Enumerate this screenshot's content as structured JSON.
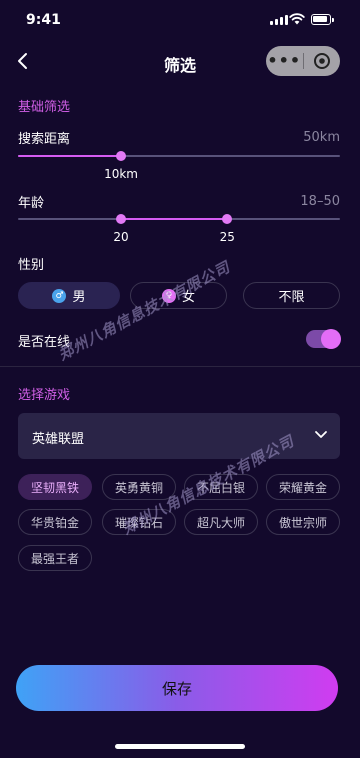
{
  "status": {
    "time": "9:41"
  },
  "nav": {
    "title": "筛选",
    "capsule_dots": "•••"
  },
  "basic": {
    "section_title": "基础筛选",
    "distance": {
      "label": "搜索距离",
      "max_label": "50km",
      "value_label": "10km",
      "value_fraction": 0.32
    },
    "age": {
      "label": "年龄",
      "range_label": "18–50",
      "low_label": "20",
      "high_label": "25",
      "low_fraction": 0.32,
      "high_fraction": 0.65
    },
    "gender": {
      "label": "性别",
      "options": [
        {
          "label": "男",
          "icon": "male-icon",
          "active": true
        },
        {
          "label": "女",
          "icon": "female-icon",
          "active": false
        },
        {
          "label": "不限",
          "icon": "",
          "active": false
        }
      ]
    },
    "online": {
      "label": "是否在线",
      "enabled": true
    }
  },
  "games": {
    "section_title": "选择游戏",
    "selected_game": "英雄联盟",
    "ranks": [
      "坚韧黑铁",
      "英勇黄铜",
      "不屈白银",
      "荣耀黄金",
      "华贵铂金",
      "璀璨钻石",
      "超凡大师",
      "傲世宗师",
      "最强王者"
    ],
    "active_rank": "坚韧黑铁"
  },
  "watermark": "郑州八角信息技术有限公司",
  "save_label": "保存",
  "colors": {
    "background": "#13092c",
    "accent": "#d55cf2",
    "section_title": "#d15fe6",
    "save_gradient_start": "#3fa2f6",
    "save_gradient_end": "#d03cf0"
  }
}
